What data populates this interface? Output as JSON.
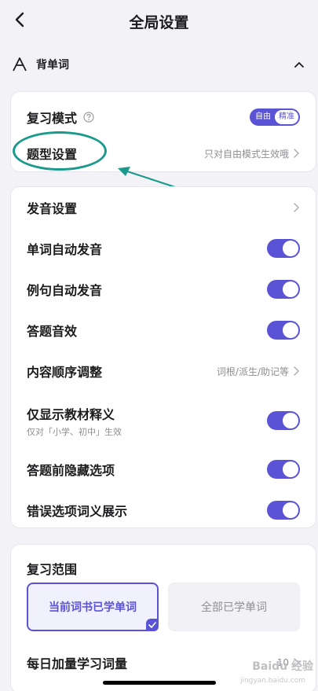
{
  "header": {
    "title": "全局设置",
    "back_icon": "chevron-left-icon"
  },
  "section": {
    "label": "背单词",
    "icon": "letter-a-icon",
    "collapse_icon": "chevron-up-icon"
  },
  "card1": {
    "review_mode": {
      "label": "复习模式",
      "help_icon": "question-circle-icon",
      "options": [
        "自由",
        "精准"
      ],
      "selected": "精准"
    },
    "question_type": {
      "label": "题型设置",
      "hint": "只对自由模式生效哦"
    }
  },
  "card2": {
    "pronunciation": {
      "label": "发音设置"
    },
    "word_auto_pronounce": {
      "label": "单词自动发音",
      "on": true
    },
    "sentence_auto_pronounce": {
      "label": "例句自动发音",
      "on": true
    },
    "answer_sound": {
      "label": "答题音效",
      "on": true
    },
    "content_order": {
      "label": "内容顺序调整",
      "hint": "词根/派生/助记等"
    },
    "textbook_only": {
      "label": "仅显示教材释义",
      "sub": "仅对「小学、初中」生效",
      "on": true
    },
    "hide_options": {
      "label": "答题前隐藏选项",
      "on": true
    },
    "wrong_option_meaning": {
      "label": "错误选项词义展示",
      "on": true
    }
  },
  "card3": {
    "title": "复习范围",
    "options": [
      "当前词书已学单词",
      "全部已学单词"
    ],
    "selected_index": 0,
    "daily_add": {
      "label": "每日加量学习词量",
      "value": "10"
    }
  },
  "watermark": {
    "main": "Baidu 经验",
    "sub": "jingyan.baidu.com"
  },
  "colors": {
    "accent": "#5b53d6",
    "annotation": "#1a9a8c",
    "background": "#f3f3f7"
  }
}
